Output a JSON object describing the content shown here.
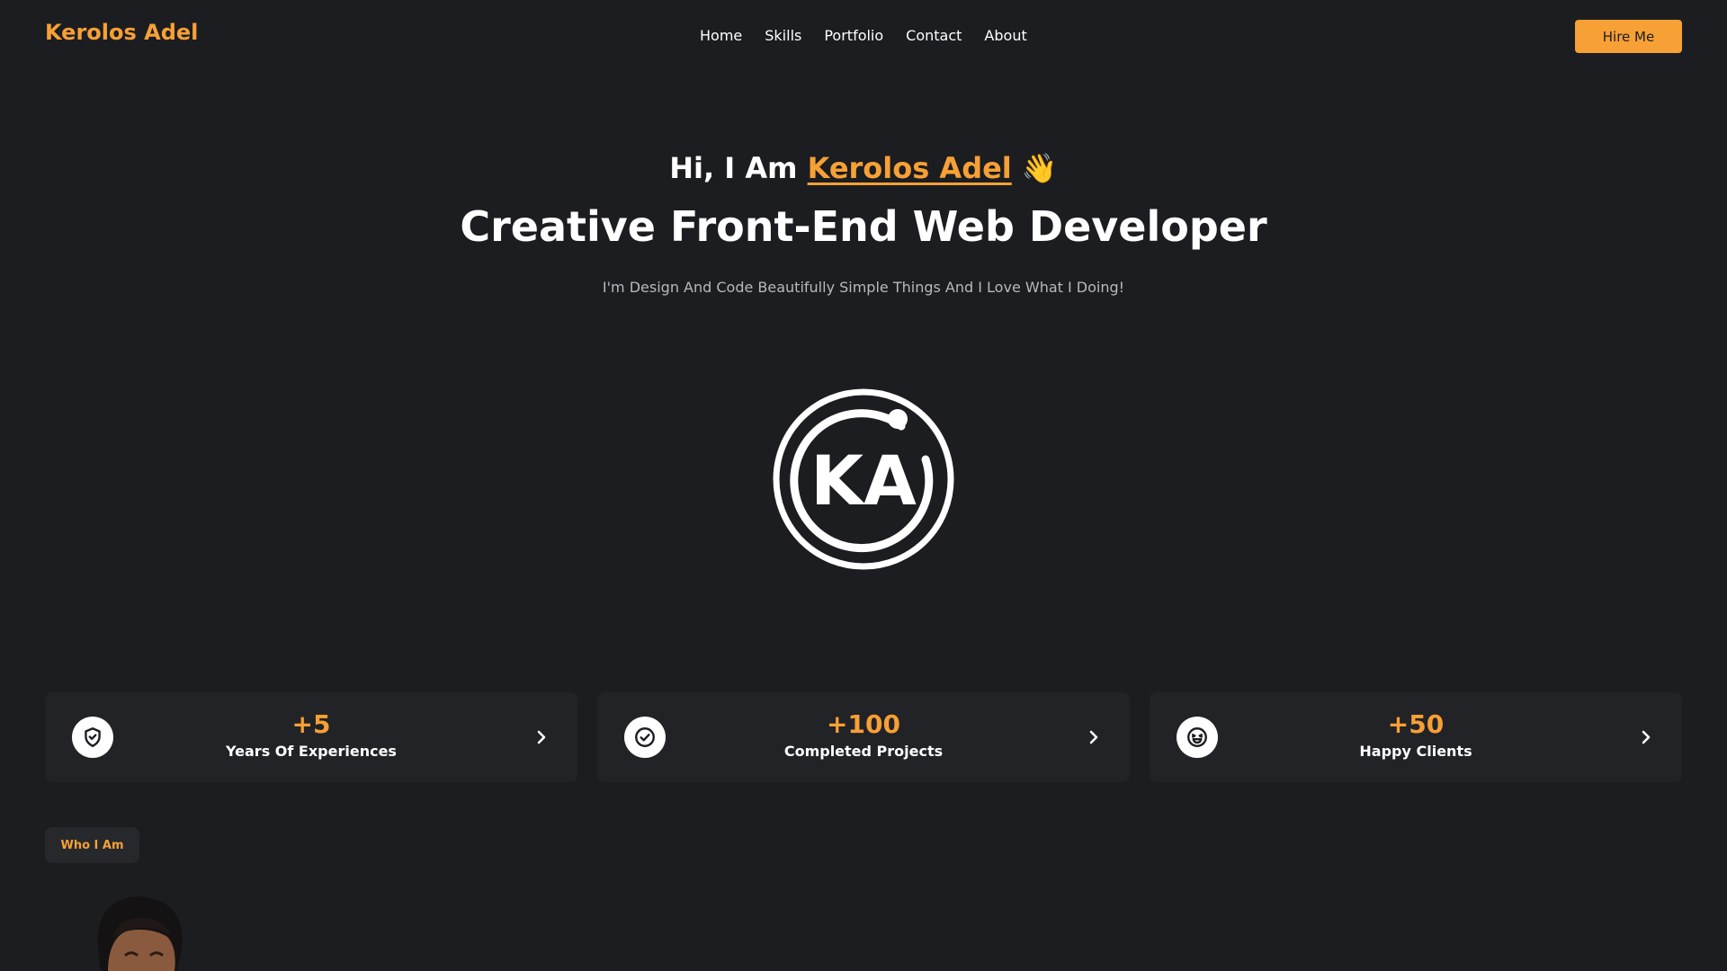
{
  "nav": {
    "brand": "Kerolos Adel",
    "links": [
      "Home",
      "Skills",
      "Portfolio",
      "Contact",
      "About"
    ],
    "hire_button": "Hire Me"
  },
  "hero": {
    "greeting_prefix": "Hi, I Am ",
    "greeting_name": "Kerolos Adel",
    "greeting_emoji": "👋",
    "headline": "Creative Front-End Web Developer",
    "tagline": "I'm Design And Code Beautifully Simple Things And I Love What I Doing!",
    "logo_text": "KA"
  },
  "stats": [
    {
      "icon": "shield-check-icon",
      "value": "+5",
      "label": "Years Of Experiences"
    },
    {
      "icon": "check-circle-icon",
      "value": "+100",
      "label": "Completed Projects"
    },
    {
      "icon": "happy-face-icon",
      "value": "+50",
      "label": "Happy Clients"
    }
  ],
  "about": {
    "badge": "Who I Am"
  },
  "colors": {
    "accent": "#f7a035",
    "background": "#1b1d21",
    "card": "#222327",
    "text": "#ffffff",
    "muted": "#b6b9be"
  }
}
